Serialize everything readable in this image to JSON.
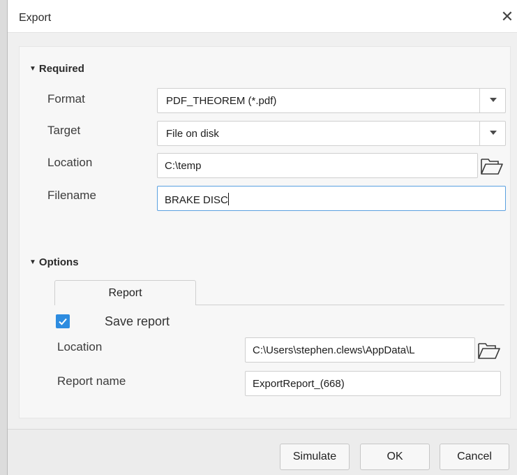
{
  "window": {
    "title": "Export",
    "close_glyph": "✕"
  },
  "required": {
    "heading": "Required",
    "format": {
      "label": "Format",
      "value": "PDF_THEOREM (*.pdf)"
    },
    "target": {
      "label": "Target",
      "value": "File on disk"
    },
    "location": {
      "label": "Location",
      "value": "C:\\temp"
    },
    "filename": {
      "label": "Filename",
      "value": "BRAKE DISC"
    }
  },
  "options": {
    "heading": "Options",
    "tabs": [
      {
        "label": "Report"
      }
    ],
    "save_report": {
      "label": "Save report",
      "checked": true
    },
    "location": {
      "label": "Location",
      "value": "C:\\Users\\stephen.clews\\AppData\\L"
    },
    "report_name": {
      "label": "Report name",
      "value": "ExportReport_(668)"
    }
  },
  "buttons": {
    "simulate": "Simulate",
    "ok": "OK",
    "cancel": "Cancel"
  },
  "icons": {
    "collapse": "triangle-down-icon",
    "folder": "folder-open-icon",
    "check": "check-icon"
  },
  "colors": {
    "accent": "#2d8ce0",
    "focus_border": "#5aa0e0"
  }
}
